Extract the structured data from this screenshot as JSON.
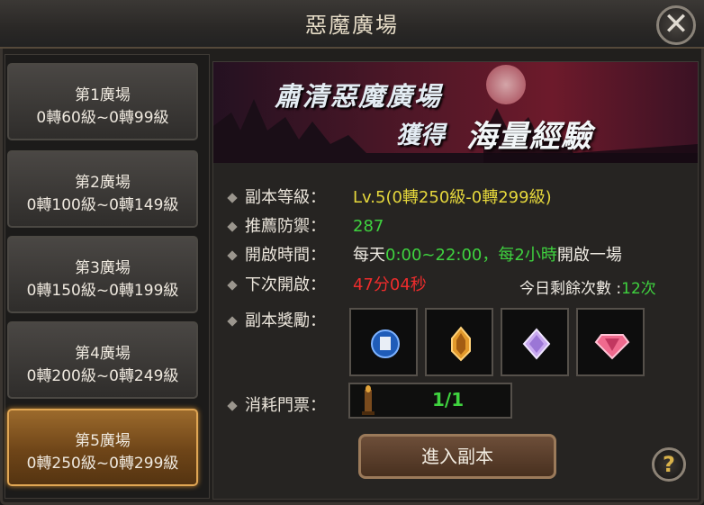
{
  "window": {
    "title": "惡魔廣場",
    "close_glyph": "✕"
  },
  "stages": [
    {
      "name": "第1廣場",
      "range": "0轉60級~0轉99級",
      "active": false
    },
    {
      "name": "第2廣場",
      "range": "0轉100級~0轉149級",
      "active": false
    },
    {
      "name": "第3廣場",
      "range": "0轉150級~0轉199級",
      "active": false
    },
    {
      "name": "第4廣場",
      "range": "0轉200級~0轉249級",
      "active": false
    },
    {
      "name": "第5廣場",
      "range": "0轉250級~0轉299級",
      "active": true
    }
  ],
  "banner": {
    "line1": "肅清惡魔廣場",
    "line2a": "獲得",
    "line2b": "海量經驗"
  },
  "info": {
    "level_label": "副本等級：",
    "level_value": "Lv.5(0轉250級-0轉299級)",
    "defense_label": "推薦防禦：",
    "defense_value": "287",
    "open_label": "開啟時間：",
    "open_part1": "每天",
    "open_part2": "0:00~22:00，每2小時",
    "open_part3": "開啟一場",
    "next_label": "下次開啟：",
    "next_value": "47分04秒",
    "remaining_label": "今日剩餘次數 :",
    "remaining_value": "12次",
    "reward_label": "副本獎勵：",
    "ticket_label": "消耗門票：",
    "ticket_count": "1/1"
  },
  "rewards": [
    {
      "icon": "blue-scroll-orb-icon",
      "color": "#2a6fd1"
    },
    {
      "icon": "amber-crystal-icon",
      "color": "#e39a2b"
    },
    {
      "icon": "purple-diamond-icon",
      "color": "#c8a9f0"
    },
    {
      "icon": "pink-gem-icon",
      "color": "#f06a8e"
    }
  ],
  "actions": {
    "enter_label": "進入副本",
    "help_glyph": "?"
  }
}
